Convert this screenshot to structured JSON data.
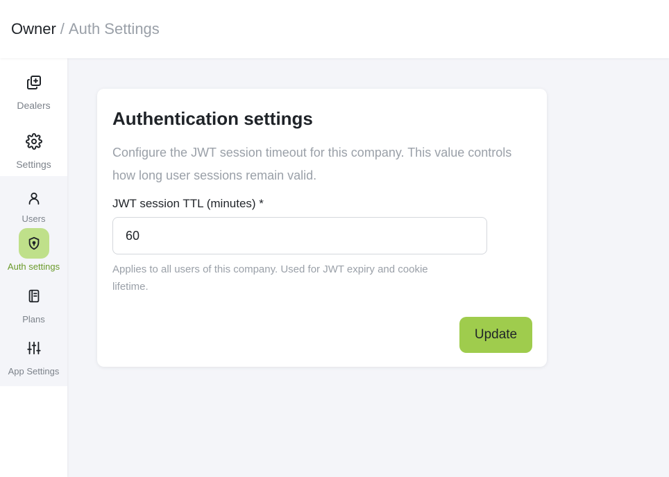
{
  "header": {
    "breadcrumb_root": "Owner",
    "breadcrumb_separator": "/",
    "breadcrumb_current": "Auth Settings"
  },
  "sidebar": {
    "items": [
      {
        "label": "Dealers",
        "icon": "dealers-icon"
      },
      {
        "label": "Settings",
        "icon": "gear-icon"
      },
      {
        "label": "Users",
        "icon": "user-icon"
      },
      {
        "label": "Auth settings",
        "icon": "shield-icon",
        "active": true
      },
      {
        "label": "Plans",
        "icon": "notebook-icon"
      },
      {
        "label": "App Settings",
        "icon": "sliders-icon"
      }
    ]
  },
  "card": {
    "title": "Authentication settings",
    "description": "Configure the JWT session timeout for this company. This value controls how long user sessions remain valid.",
    "field_label": "JWT session TTL (minutes) *",
    "field_value": "60",
    "field_help": "Applies to all users of this company. Used for JWT expiry and cookie lifetime.",
    "update_label": "Update"
  },
  "colors": {
    "accent": "#9fcc4d",
    "accent_light": "#bfe08a",
    "accent_text": "#6a9a2a",
    "muted_text": "#9aa0a8",
    "background": "#f4f5f9"
  }
}
